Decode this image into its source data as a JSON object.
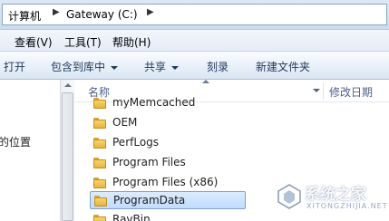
{
  "address_bar": {
    "crumbs": [
      "计算机",
      "Gateway (C:)"
    ],
    "separator": "▶"
  },
  "menu": {
    "items": [
      "查看(V)",
      "工具(T)",
      "帮助(H)"
    ]
  },
  "toolbar": {
    "open": "打开",
    "include_in_library": "包含到库中",
    "share": "共享",
    "burn": "刻录",
    "new_folder": "新建文件夹"
  },
  "nav_pane": {
    "partial_item": "的位置"
  },
  "file_list": {
    "columns": {
      "name": "名称",
      "date_modified": "修改日期"
    },
    "items": [
      {
        "name": "myMemcached",
        "selected": false
      },
      {
        "name": "OEM",
        "selected": false
      },
      {
        "name": "PerfLogs",
        "selected": false
      },
      {
        "name": "Program Files",
        "selected": false
      },
      {
        "name": "Program Files (x86)",
        "selected": false
      },
      {
        "name": "ProgramData",
        "selected": true
      },
      {
        "name": "RavBin",
        "selected": false
      }
    ]
  },
  "watermark": {
    "text": "系统之家",
    "subtext": "XITONGZHIJIA.NET"
  },
  "colors": {
    "selection": "#c1dcfc",
    "folder": "#f6d56f",
    "header_text": "#4d6185"
  }
}
